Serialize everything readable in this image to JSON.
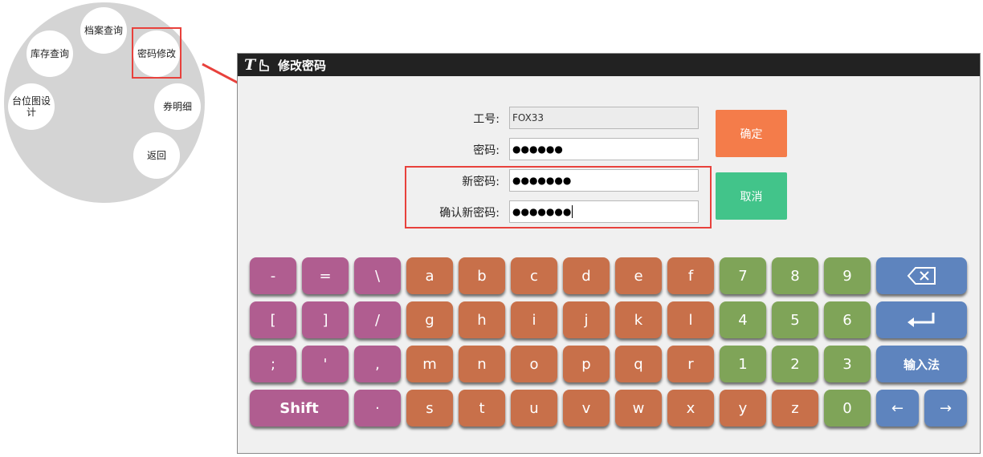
{
  "circular_menu": {
    "items": [
      {
        "label": "档案查询"
      },
      {
        "label": "库存查询"
      },
      {
        "label": "密码修改"
      },
      {
        "label": "台位图设计"
      },
      {
        "label": "券明细"
      },
      {
        "label": "返回"
      }
    ]
  },
  "window": {
    "title": "修改密码"
  },
  "form": {
    "employee_id_label": "工号:",
    "employee_id_value": "FOX33",
    "password_label": "密码:",
    "password_mask": "●●●●●●",
    "new_password_label": "新密码:",
    "new_password_mask": "●●●●●●●",
    "confirm_password_label": "确认新密码:",
    "confirm_password_mask": "●●●●●●●"
  },
  "buttons": {
    "confirm": "确定",
    "cancel": "取消"
  },
  "keyboard": {
    "rows": [
      [
        "-",
        "=",
        "\\",
        "a",
        "b",
        "c",
        "d",
        "e",
        "f",
        "7",
        "8",
        "9"
      ],
      [
        "[",
        "]",
        "/",
        "g",
        "h",
        "i",
        "j",
        "k",
        "l",
        "4",
        "5",
        "6"
      ],
      [
        ";",
        "'",
        ",",
        "m",
        "n",
        "o",
        "p",
        "q",
        "r",
        "1",
        "2",
        "3"
      ],
      [
        "Shift",
        "·",
        "s",
        "t",
        "u",
        "v",
        "w",
        "x",
        "y",
        "z",
        "0"
      ]
    ],
    "backspace_icon": "backspace-icon",
    "enter_icon": "enter-icon",
    "ime_label": "输入法",
    "left_arrow": "←",
    "right_arrow": "→"
  },
  "colors": {
    "symbol_key": "#b05d90",
    "letter_key": "#c8704a",
    "number_key": "#7fa458",
    "control_key": "#5e84be",
    "confirm_button": "#f47c4a",
    "cancel_button": "#42c48a",
    "highlight": "#e8413c",
    "title_bar": "#222222"
  }
}
